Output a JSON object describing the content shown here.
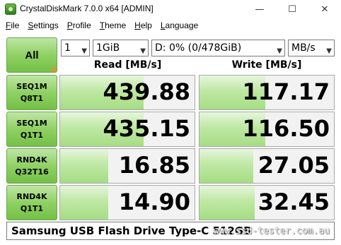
{
  "window": {
    "title": "CrystalDiskMark 7.0.0 x64 [ADMIN]",
    "minimize": "—",
    "maximize": "☐",
    "close": "✕"
  },
  "menu": [
    {
      "accel": "F",
      "rest": "ile"
    },
    {
      "accel": "S",
      "rest": "ettings"
    },
    {
      "accel": "P",
      "rest": "rofile"
    },
    {
      "accel": "T",
      "rest": "heme"
    },
    {
      "accel": "H",
      "rest": "elp"
    },
    {
      "accel": "L",
      "rest": "anguage"
    }
  ],
  "controls": {
    "all_label": "All",
    "count": "1",
    "size": "1GiB",
    "drive": "D: 0% (0/478GiB)",
    "unit": "MB/s"
  },
  "headers": {
    "read": "Read [MB/s]",
    "write": "Write [MB/s]"
  },
  "tests": [
    {
      "line1": "SEQ1M",
      "line2": "Q8T1",
      "read": "439.88",
      "write": "117.17",
      "read_fill": 0.62,
      "write_fill": 0.49
    },
    {
      "line1": "SEQ1M",
      "line2": "Q1T1",
      "read": "435.15",
      "write": "116.50",
      "read_fill": 0.62,
      "write_fill": 0.49
    },
    {
      "line1": "RND4K",
      "line2": "Q32T16",
      "read": "16.85",
      "write": "27.05",
      "read_fill": 0.36,
      "write_fill": 0.4
    },
    {
      "line1": "RND4K",
      "line2": "Q1T1",
      "read": "14.90",
      "write": "32.45",
      "read_fill": 0.36,
      "write_fill": 0.41
    }
  ],
  "footer": {
    "comment": "Samsung USB Flash Drive Type-C 512GB",
    "watermark": "www.ssd-tester.com.au"
  },
  "colors": {
    "button_green": "#8fd163",
    "bar_green": "#bfe8a4",
    "accent_orange": "#f28c28"
  }
}
